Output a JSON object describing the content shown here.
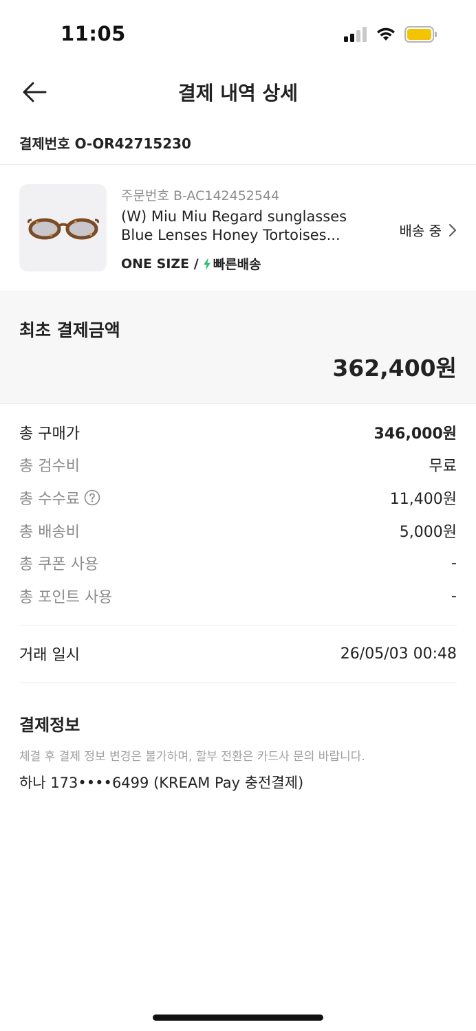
{
  "status_bar": {
    "time": "11:05"
  },
  "nav": {
    "title": "결제 내역 상세"
  },
  "payment": {
    "number_label": "결제번호 O-OR42715230"
  },
  "product": {
    "order_number": "주문번호 B-AC142452544",
    "name_line1": "(W) Miu Miu Regard sunglasses",
    "name_line2": "Blue Lenses Honey Tortoises...",
    "size": "ONE SIZE /",
    "fast_delivery": "빠른배송",
    "status": "배송 중"
  },
  "total": {
    "label": "최초 결제금액",
    "amount": "362,400원"
  },
  "breakdown": [
    {
      "label": "총 구매가",
      "value": "346,000원"
    },
    {
      "label": "총 검수비",
      "value": "무료"
    },
    {
      "label": "총 수수료",
      "value": "11,400원"
    },
    {
      "label": "총 배송비",
      "value": "5,000원"
    },
    {
      "label": "총 쿠폰 사용",
      "value": "-"
    },
    {
      "label": "총 포인트 사용",
      "value": "-"
    }
  ],
  "transaction": {
    "label": "거래 일시",
    "value": "26/05/03 00:48"
  },
  "payment_info": {
    "title": "결제정보",
    "notice": "체결 후 결제 정보 변경은 불가하며, 할부 전환은 카드사 문의 바랍니다.",
    "method": "하나 173••••6499 (KREAM Pay 충전결제)"
  },
  "colors": {
    "fast_delivery_icon": "#2fbf71",
    "battery": "#f5c400",
    "section_bg": "#f7f7f7"
  }
}
